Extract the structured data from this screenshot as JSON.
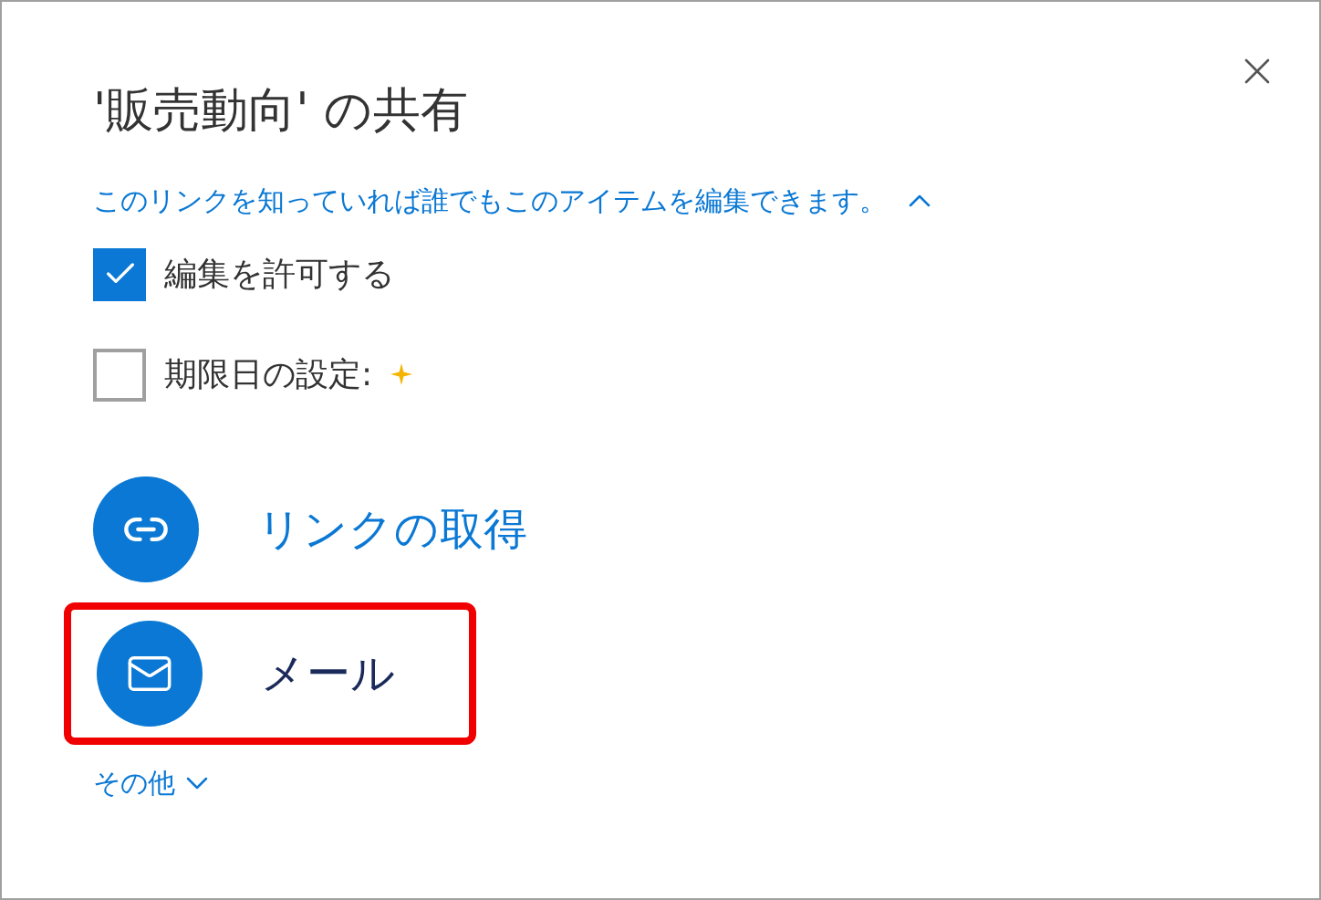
{
  "dialog": {
    "title": "'販売動向' の共有"
  },
  "link_info": {
    "text": "このリンクを知っていれば誰でもこのアイテムを編集できます。",
    "expanded": true
  },
  "options": [
    {
      "label": "編集を許可する",
      "checked": true,
      "premium": false
    },
    {
      "label": "期限日の設定:",
      "checked": false,
      "premium": true
    }
  ],
  "actions": [
    {
      "kind": "link",
      "label": "リンクの取得",
      "highlighted": false
    },
    {
      "kind": "mail",
      "label": "メール",
      "highlighted": true
    }
  ],
  "more": {
    "label": "その他",
    "expanded": false
  }
}
